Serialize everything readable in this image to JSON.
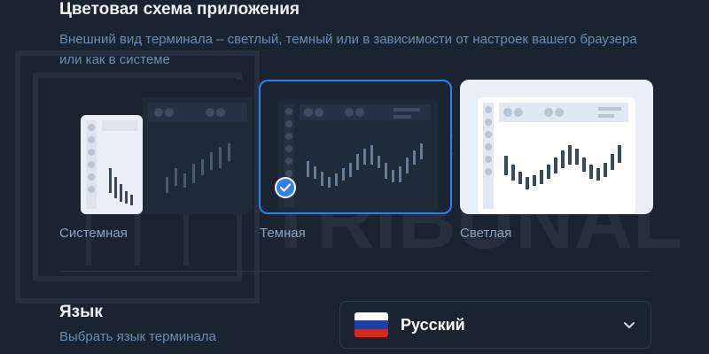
{
  "color_scheme": {
    "title": "Цветовая схема приложения",
    "description": "Внешний вид терминала – светлый, темный или в зависимости от настроек вашего браузера или как в системе",
    "options": [
      {
        "label": "Системная",
        "selected": false
      },
      {
        "label": "Темная",
        "selected": true
      },
      {
        "label": "Светлая",
        "selected": false
      }
    ]
  },
  "language": {
    "title": "Язык",
    "description": "Выбрать язык терминала",
    "selected": "Русский"
  },
  "watermark": "BROKERS TRIBUNAL",
  "colors": {
    "background": "#1a2330",
    "accent": "#2f80ed",
    "flag": [
      "#ffffff",
      "#1c3fa8",
      "#d52b1e"
    ]
  }
}
